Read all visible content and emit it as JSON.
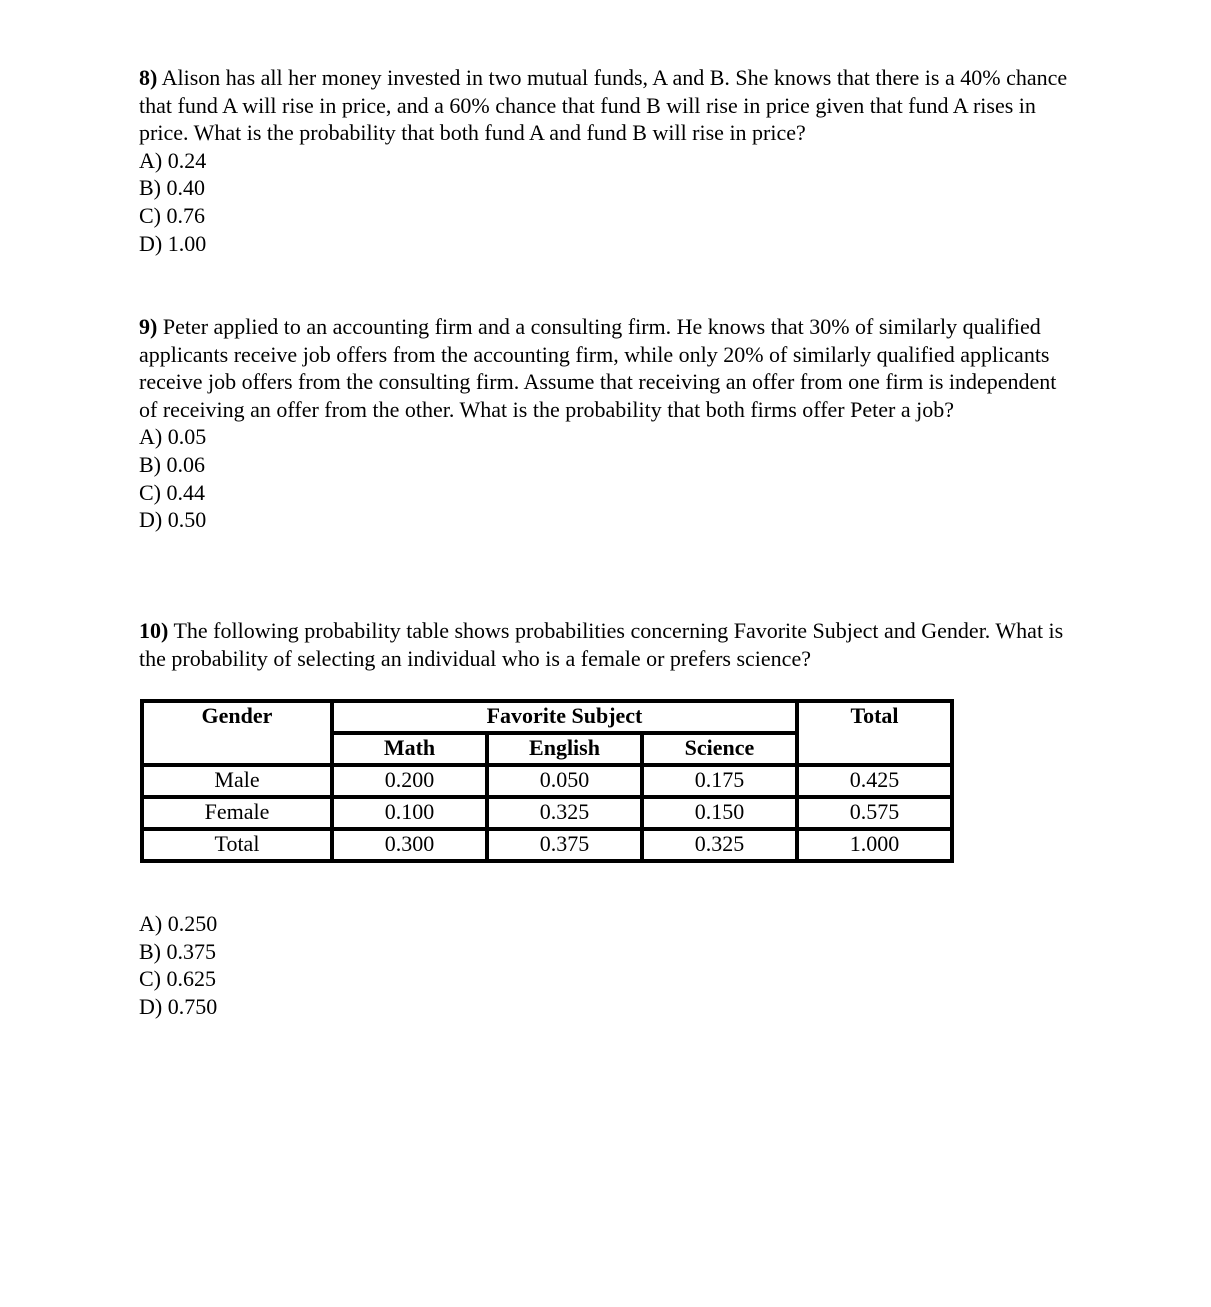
{
  "questions": [
    {
      "number": "8)",
      "text": "Alison has all her money invested in two mutual funds, A and B. She knows that there is a 40% chance that fund A will rise in price, and a 60% chance that fund B will rise in price given that fund A rises in price. What is the probability that both fund A and fund B will rise in price?",
      "options": [
        "A) 0.24",
        "B) 0.40",
        "C) 0.76",
        "D) 1.00"
      ]
    },
    {
      "number": "9)",
      "text": "Peter applied to an accounting firm and a consulting firm. He knows that 30% of similarly qualified applicants receive job offers from the accounting firm, while only 20% of similarly qualified applicants receive job offers from the consulting firm. Assume that receiving an offer from one firm is independent of receiving an offer from the other. What is the probability that both firms offer Peter a job?",
      "options": [
        "A) 0.05",
        "B) 0.06",
        "C) 0.44",
        "D) 0.50"
      ]
    },
    {
      "number": "10)",
      "text": "The following probability table shows probabilities concerning Favorite Subject and Gender. What is the probability of selecting an individual who is a female or prefers science?",
      "options": [
        "A) 0.250",
        "B) 0.375",
        "C) 0.625",
        "D) 0.750"
      ]
    }
  ],
  "table": {
    "header_gender": "Gender",
    "header_subject": "Favorite Subject",
    "header_total": "Total",
    "subjects": [
      "Math",
      "English",
      "Science"
    ],
    "rows": [
      {
        "label": "Male",
        "values": [
          "0.200",
          "0.050",
          "0.175"
        ],
        "total": "0.425"
      },
      {
        "label": "Female",
        "values": [
          "0.100",
          "0.325",
          "0.150"
        ],
        "total": "0.575"
      },
      {
        "label": "Total",
        "values": [
          "0.300",
          "0.375",
          "0.325"
        ],
        "total": "1.000"
      }
    ]
  }
}
